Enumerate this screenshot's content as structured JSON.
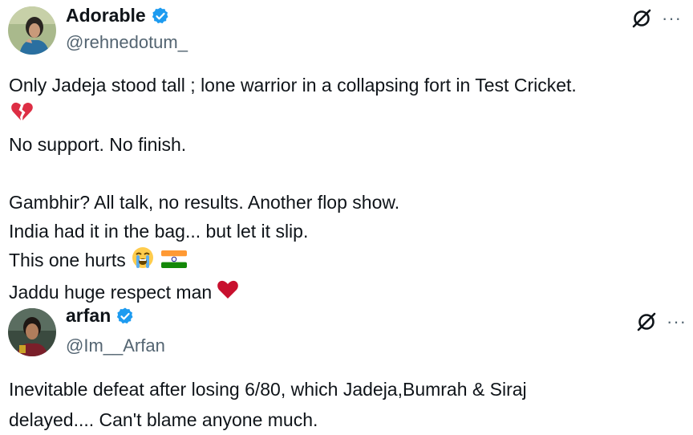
{
  "tweets": [
    {
      "display_name": "Adorable",
      "handle": "@rehnedotum_",
      "verified": true,
      "lines": [
        "Only Jadeja stood tall ;  lone warrior in a collapsing fort in Test Cricket.",
        "No support. No finish.",
        "Gambhir? All talk, no results. Another flop show.",
        "India had it in the bag... but let it slip.",
        "This one hurts",
        "Jaddu huge respect man"
      ],
      "icons": [
        "broken-heart-icon",
        "loudly-crying-face-icon",
        "india-flag-icon",
        "red-heart-icon"
      ]
    },
    {
      "display_name": "arfan",
      "handle": "@Im__Arfan",
      "verified": true,
      "lines": [
        "Inevitable defeat after losing 6/80, which Jadeja,Bumrah & Siraj",
        "delayed.... Can't blame anyone much."
      ]
    }
  ],
  "menu": {
    "more_label": "···"
  },
  "colors": {
    "verified": "#1d9bf0",
    "text": "#0f1419",
    "secondary": "#536471",
    "heart": "#c8102e"
  }
}
